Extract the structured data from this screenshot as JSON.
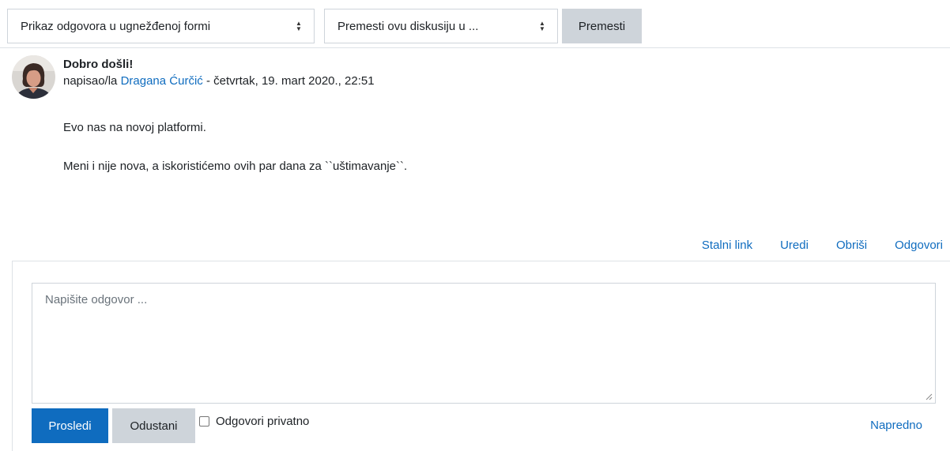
{
  "controls": {
    "display_mode": "Prikaz odgovora u ugnežđenoj formi",
    "move_target": "Premesti ovu diskusiju u ...",
    "move_button": "Premesti"
  },
  "post": {
    "title": "Dobro došli!",
    "meta_prefix": "napisao/la",
    "author": "Dragana Ćurčić",
    "meta_suffix": " - četvrtak, 19. mart 2020., 22:51",
    "paragraphs": [
      "Evo nas na novoj platformi.",
      "Meni i nije nova, a iskoristićemo ovih par dana za ``uštimavanje``."
    ],
    "actions": {
      "permalink": "Stalni link",
      "edit": "Uredi",
      "delete": "Obriši",
      "reply": "Odgovori"
    }
  },
  "reply": {
    "placeholder": "Napišite odgovor ...",
    "submit": "Prosledi",
    "cancel": "Odustani",
    "private_label": "Odgovori privatno",
    "advanced": "Napredno"
  },
  "colors": {
    "link": "#0f6cbf",
    "primary": "#0f6cbf",
    "secondary": "#ced4da"
  }
}
